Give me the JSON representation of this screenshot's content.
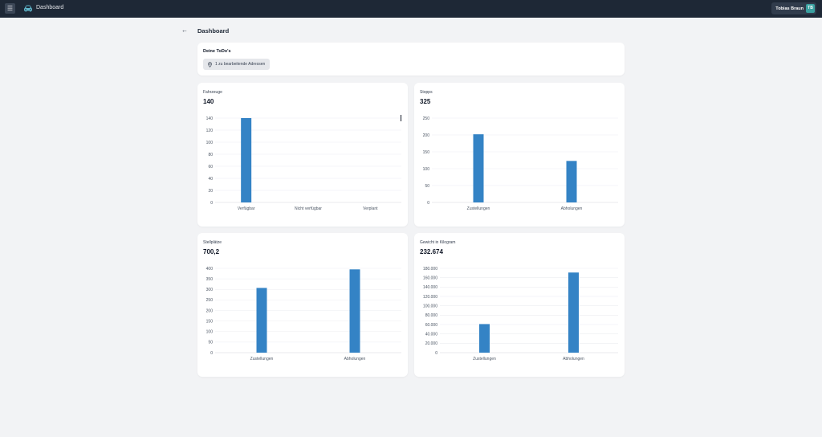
{
  "topbar": {
    "menu_icon": "hamburger-icon",
    "brand_icon": "car-icon",
    "title": "Dashboard",
    "user_name": "Tobias Braun",
    "user_initials": "TB"
  },
  "page": {
    "back_icon": "arrow-left-icon",
    "title": "Dashboard"
  },
  "todos": {
    "title": "Deine ToDo's",
    "chip_icon": "location-pin-icon",
    "chip_label": "1 zu bearbeitende Adressen"
  },
  "cards": [
    {
      "label": "Fahrzeuge",
      "value": "140"
    },
    {
      "label": "Stopps",
      "value": "325"
    },
    {
      "label": "Stellplätze",
      "value": "700,2"
    },
    {
      "label": "Gewicht in Kilogram",
      "value": "232.674"
    }
  ],
  "colors": {
    "bar": "#3483c5",
    "topbar": "#1e2836",
    "avatar": "#3aa0a0"
  },
  "chart_data": [
    {
      "type": "bar",
      "categories": [
        "Verfügbar",
        "Nicht verfügbar",
        "Verplant"
      ],
      "values": [
        140,
        0,
        0
      ],
      "ylim": [
        0,
        140
      ],
      "yticks": [
        0,
        20,
        40,
        60,
        80,
        100,
        120,
        140
      ],
      "ytick_labels": [
        "0",
        "20",
        "40",
        "60",
        "80",
        "100",
        "120",
        "140"
      ],
      "grid": true
    },
    {
      "type": "bar",
      "categories": [
        "Zustellungen",
        "Abholungen"
      ],
      "values": [
        202,
        123
      ],
      "ylim": [
        0,
        250
      ],
      "yticks": [
        0,
        50,
        100,
        150,
        200,
        250
      ],
      "ytick_labels": [
        "0",
        "50",
        "100",
        "150",
        "200",
        "250"
      ],
      "grid": true
    },
    {
      "type": "bar",
      "categories": [
        "Zustellungen",
        "Abholungen"
      ],
      "values": [
        307,
        395
      ],
      "ylim": [
        0,
        400
      ],
      "yticks": [
        0,
        50,
        100,
        150,
        200,
        250,
        300,
        350,
        400
      ],
      "ytick_labels": [
        "0",
        "50",
        "100",
        "150",
        "200",
        "250",
        "300",
        "350",
        "400"
      ],
      "grid": true
    },
    {
      "type": "bar",
      "categories": [
        "Zustellungen",
        "Abholungen"
      ],
      "values": [
        61000,
        171000
      ],
      "ylim": [
        0,
        180000
      ],
      "yticks": [
        0,
        20000,
        40000,
        60000,
        80000,
        100000,
        120000,
        140000,
        160000,
        180000
      ],
      "ytick_labels": [
        "0",
        "20.000",
        "40.000",
        "60.000",
        "80.000",
        "100.000",
        "120.000",
        "140.000",
        "160.000",
        "180.000"
      ],
      "grid": true
    }
  ]
}
